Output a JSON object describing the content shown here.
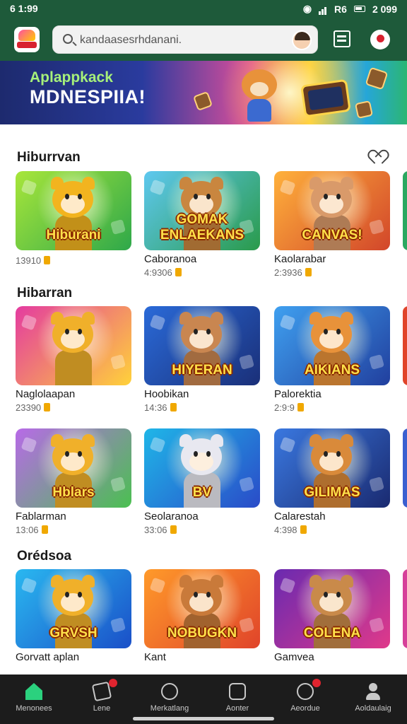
{
  "status_bar": {
    "time": "6 1:99",
    "battery_text": "2 099",
    "network_text": "R6"
  },
  "header": {
    "search_placeholder": "kandaasesrhdanani."
  },
  "banner": {
    "subtitle": "Aplappkack",
    "title": "MDNESPIIA!"
  },
  "sections": [
    {
      "title": "Hiburrvan",
      "cards": [
        {
          "title": "",
          "meta": "13910",
          "logo_text": "Hiburani",
          "colors": [
            "#a8e63a",
            "#2ea84a"
          ],
          "char": "#f2b41f"
        },
        {
          "title": "Caboranoa",
          "meta": "4:9306",
          "logo_text": "GOMAK ENLAEKANS",
          "colors": [
            "#5ec8f0",
            "#2a9a4a"
          ],
          "char": "#c9863f"
        },
        {
          "title": "Kaolarabar",
          "meta": "2:3936",
          "logo_text": "CANVAS!",
          "colors": [
            "#ffb13b",
            "#d2462a"
          ],
          "char": "#d99a6a"
        }
      ]
    },
    {
      "title": "Hibarran",
      "cards": [
        {
          "title": "Naglolaapan",
          "meta": "23390",
          "logo_text": "",
          "colors": [
            "#e43ba0",
            "#ffd23a"
          ],
          "char": "#f0b02a"
        },
        {
          "title": "Hoobikan",
          "meta": "14:36",
          "logo_text": "HIYERAN",
          "colors": [
            "#2a6ad8",
            "#1a2f78"
          ],
          "char": "#c98650"
        },
        {
          "title": "Palorektia",
          "meta": "2:9:9",
          "logo_text": "AIKIANS",
          "colors": [
            "#3fa0f0",
            "#213f9e"
          ],
          "char": "#e8923a"
        }
      ]
    },
    {
      "title": "",
      "cards": [
        {
          "title": "Fablarman",
          "meta": "13:06",
          "logo_text": "Hblars",
          "colors": [
            "#b86ae8",
            "#4ac050"
          ],
          "char": "#f0b02a"
        },
        {
          "title": "Seolaranoa",
          "meta": "33:06",
          "logo_text": "BV",
          "colors": [
            "#1fb6e8",
            "#2a4bc8"
          ],
          "char": "#e8e8f0"
        },
        {
          "title": "Calarestah",
          "meta": "4:398",
          "logo_text": "GILIMAS",
          "colors": [
            "#3a78e0",
            "#1a2a70"
          ],
          "char": "#d98a3a"
        }
      ]
    },
    {
      "title": "Orédsoa",
      "cards": [
        {
          "title": "Gorvatt aplan",
          "meta": "",
          "logo_text": "GRVSH",
          "colors": [
            "#2ab8f0",
            "#1a4fc8"
          ],
          "char": "#f0b02a"
        },
        {
          "title": "Kant",
          "meta": "",
          "logo_text": "NOBUGKN",
          "colors": [
            "#ff9a2a",
            "#e0442a"
          ],
          "char": "#c97a3a"
        },
        {
          "title": "Gamvea",
          "meta": "",
          "logo_text": "COLENA",
          "colors": [
            "#6a2ab0",
            "#e0398a"
          ],
          "char": "#c98a4a"
        }
      ]
    }
  ],
  "bottom_nav": [
    {
      "label": "Menonees",
      "icon": "home-icon",
      "active": true
    },
    {
      "label": "Lene",
      "icon": "game-icon",
      "active": false
    },
    {
      "label": "Merkatlang",
      "icon": "market-icon",
      "active": false
    },
    {
      "label": "Aonter",
      "icon": "account-icon",
      "active": false
    },
    {
      "label": "Aeordue",
      "icon": "search-icon",
      "active": false
    },
    {
      "label": "Aoldaulaig",
      "icon": "user-icon",
      "active": false
    }
  ]
}
